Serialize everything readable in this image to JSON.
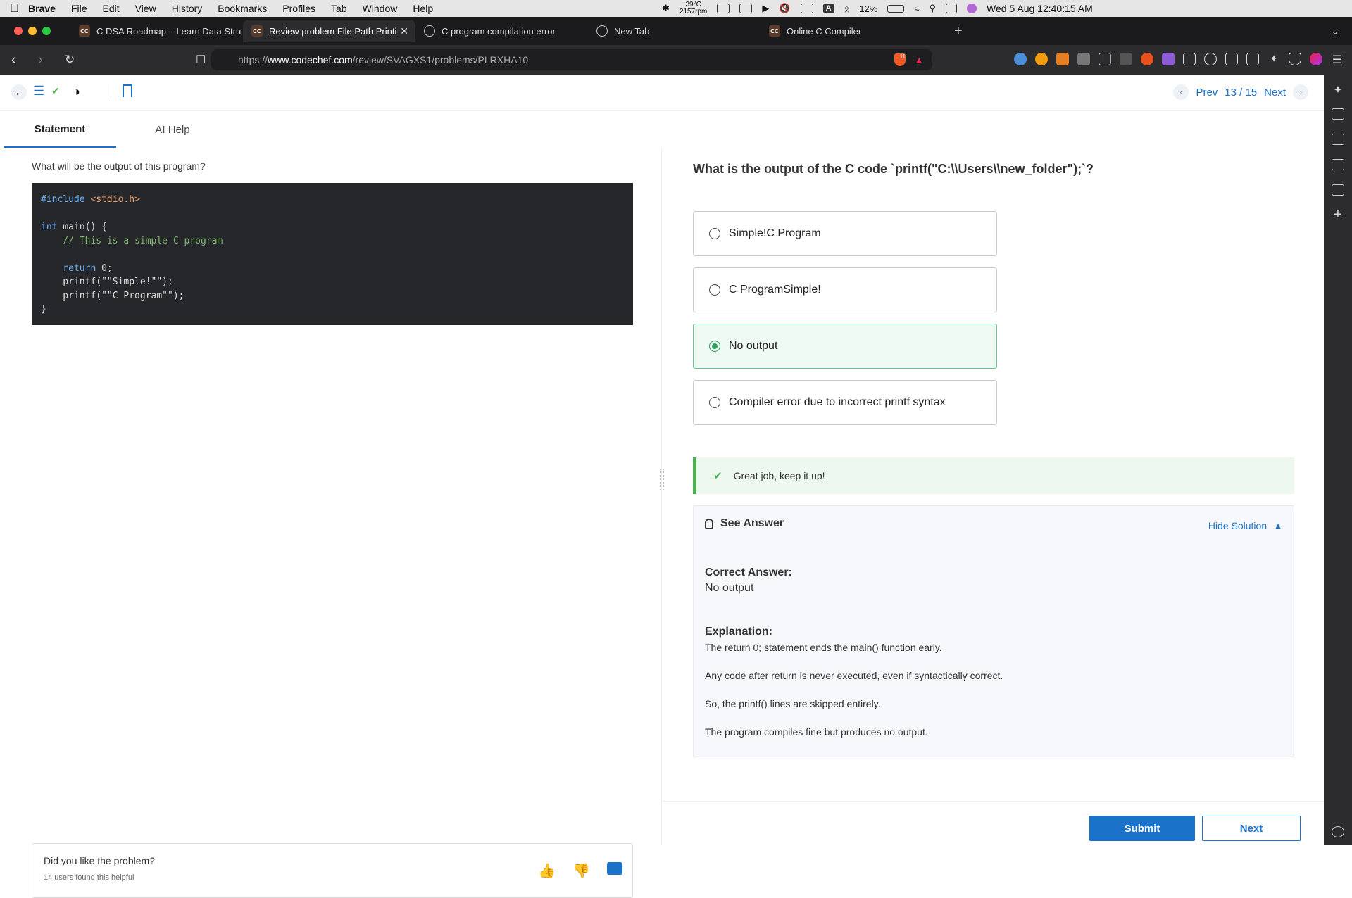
{
  "menubar": {
    "items": [
      "Brave",
      "File",
      "Edit",
      "View",
      "History",
      "Bookmarks",
      "Profiles",
      "Tab",
      "Window",
      "Help"
    ],
    "temp": "39°C",
    "rpm": "2157rpm",
    "battery": "12%",
    "clock": "Wed 5 Aug  12:40:15 AM",
    "input_indicator": "A"
  },
  "tabs": [
    {
      "label": "C DSA Roadmap – Learn Data Stru",
      "favicon": "CC"
    },
    {
      "label": "Review problem File Path Printi",
      "favicon": "CC"
    },
    {
      "label": "C program compilation error",
      "favicon": ""
    },
    {
      "label": "New Tab",
      "favicon": ""
    },
    {
      "label": "Online C Compiler",
      "favicon": "CC"
    }
  ],
  "address": {
    "prefix": "https://",
    "host": "www.codechef.com",
    "path": "/review/SVAGXS1/problems/PLRXHA10",
    "shield_count": "11"
  },
  "pager": {
    "prev": "Prev",
    "count": "13 / 15",
    "next": "Next"
  },
  "subtabs": {
    "statement": "Statement",
    "ai_help": "AI Help"
  },
  "statement": {
    "question": "What will be the output of this program?",
    "code": {
      "l1a": "#include",
      "l1b": " <stdio.h>",
      "l3a": "int",
      "l3b": " main() {",
      "l4": "    // This is a simple C program",
      "l6a": "    return",
      "l6b": " 0;",
      "l7": "    printf(\"\"Simple!\"\");",
      "l8": "    printf(\"\"C Program\"\");",
      "l9": "}"
    }
  },
  "feedback": {
    "question": "Did you like the problem?",
    "stats": "14 users found this helpful"
  },
  "quiz": {
    "question": "What is the output of the C code `printf(\"C:\\\\Users\\\\new_folder\");`?",
    "options": [
      {
        "label": "Simple!C Program"
      },
      {
        "label": "C ProgramSimple!"
      },
      {
        "label": "No output"
      },
      {
        "label": "Compiler error due to incorrect printf syntax"
      }
    ],
    "selected_index": 2,
    "success_message": "Great job, keep it up!",
    "see_answer": "See Answer",
    "hide_solution": "Hide Solution",
    "correct_answer_label": "Correct Answer:",
    "correct_answer": "No output",
    "explanation_label": "Explanation:",
    "explanation": [
      "The return 0; statement ends the main() function early.",
      "Any code after return is never executed, even if syntactically correct.",
      "So, the printf() lines are skipped entirely.",
      "The program compiles fine but produces no output."
    ]
  },
  "footer": {
    "submit": "Submit",
    "next": "Next"
  },
  "colors": {
    "accent": "#1a73c8",
    "success": "#4caf50",
    "selected_bg": "#eefaf3"
  }
}
